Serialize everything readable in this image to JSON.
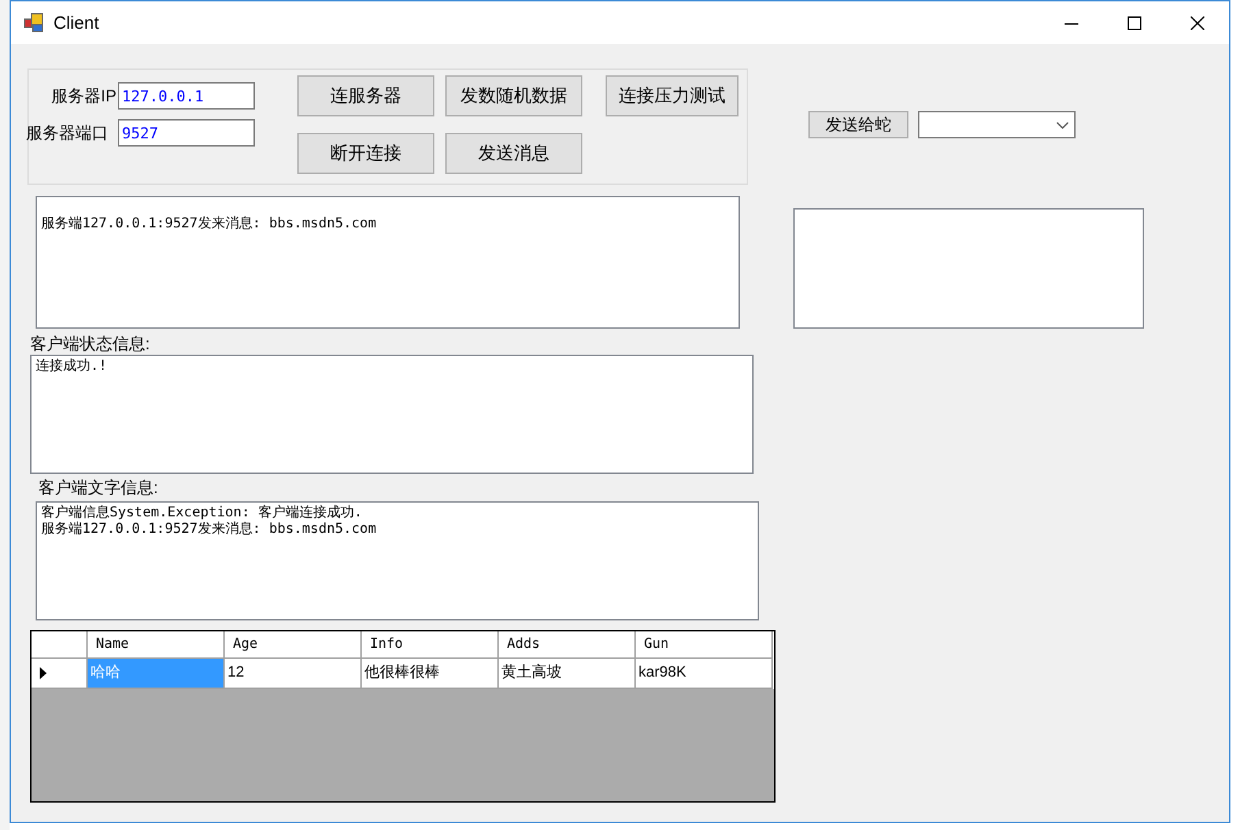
{
  "window": {
    "title": "Client"
  },
  "server": {
    "ip_label": "服务器IP",
    "ip": "127.0.0.1",
    "port_label": "服务器端口",
    "port": "9527"
  },
  "buttons": [
    {
      "label": "连服务器"
    },
    {
      "label": "发数随机数据"
    },
    {
      "label": "连接压力测试"
    },
    {
      "label": "断开连接"
    },
    {
      "label": "发送消息"
    }
  ],
  "send_button": {
    "label": "发送给蛇"
  },
  "server_messages": {
    "lines": [
      "服务端127.0.0.1:9527发来消息: bbs.msdn5.com"
    ]
  },
  "status": {
    "label": "客户端状态信息:",
    "lines": [
      "连接成功.!"
    ]
  },
  "text_info": {
    "label": "客户端文字信息:",
    "lines": [
      "客户端信息System.Exception: 客户端连接成功.",
      "服务端127.0.0.1:9527发来消息: bbs.msdn5.com"
    ]
  },
  "table": {
    "columns": [
      "Name",
      "Age",
      "Info",
      "Adds",
      "Gun"
    ],
    "rows": [
      {
        "current": true,
        "cells": [
          {
            "text": "哈哈",
            "selected": true
          },
          {
            "text": "12",
            "selected": false
          },
          {
            "text": "他很棒很棒",
            "selected": false
          },
          {
            "text": "黄土高坡",
            "selected": false
          },
          {
            "text": "kar98K",
            "selected": false
          }
        ]
      }
    ]
  }
}
